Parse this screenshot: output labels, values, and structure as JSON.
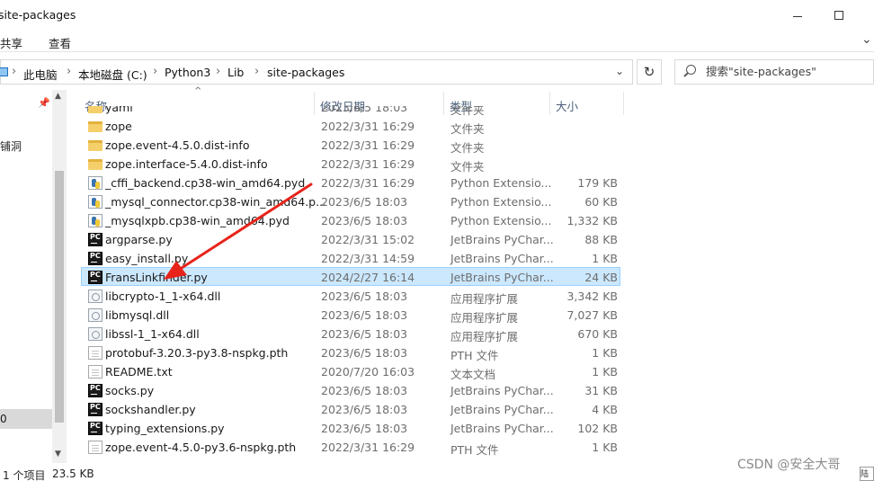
{
  "window": {
    "title": "site-packages"
  },
  "ribbon": {
    "tabs": [
      "共享",
      "查看"
    ]
  },
  "address": {
    "crumbs": [
      "此电脑",
      "本地磁盘 (C:)",
      "Python3",
      "Lib",
      "site-packages"
    ]
  },
  "search": {
    "placeholder": "搜索\"site-packages\""
  },
  "navpane": {
    "item1": "铺洞",
    "selected": "0"
  },
  "columns": {
    "name": "名称",
    "date": "修改日期",
    "type": "类型",
    "size": "大小"
  },
  "files": [
    {
      "name": "yaml",
      "date": "2023/6/5 18:03",
      "type": "文件夹",
      "size": "",
      "icon": "folder-icon"
    },
    {
      "name": "zope",
      "date": "2022/3/31 16:29",
      "type": "文件夹",
      "size": "",
      "icon": "folder-icon"
    },
    {
      "name": "zope.event-4.5.0.dist-info",
      "date": "2022/3/31 16:29",
      "type": "文件夹",
      "size": "",
      "icon": "folder-icon"
    },
    {
      "name": "zope.interface-5.4.0.dist-info",
      "date": "2022/3/31 16:29",
      "type": "文件夹",
      "size": "",
      "icon": "folder-icon"
    },
    {
      "name": "_cffi_backend.cp38-win_amd64.pyd",
      "date": "2022/3/31 16:29",
      "type": "Python Extensio...",
      "size": "179 KB",
      "icon": "python-extension-icon"
    },
    {
      "name": "_mysql_connector.cp38-win_amd64.p...",
      "date": "2023/6/5 18:03",
      "type": "Python Extensio...",
      "size": "60 KB",
      "icon": "python-extension-icon"
    },
    {
      "name": "_mysqlxpb.cp38-win_amd64.pyd",
      "date": "2023/6/5 18:03",
      "type": "Python Extensio...",
      "size": "1,332 KB",
      "icon": "python-extension-icon"
    },
    {
      "name": "argparse.py",
      "date": "2022/3/31 15:02",
      "type": "JetBrains PyChar...",
      "size": "88 KB",
      "icon": "pycharm-file-icon"
    },
    {
      "name": "easy_install.py",
      "date": "2022/3/31 14:59",
      "type": "JetBrains PyChar...",
      "size": "1 KB",
      "icon": "pycharm-file-icon"
    },
    {
      "name": "FransLinkfinder.py",
      "date": "2024/2/27 16:14",
      "type": "JetBrains PyChar...",
      "size": "24 KB",
      "icon": "pycharm-file-icon",
      "selected": true
    },
    {
      "name": "libcrypto-1_1-x64.dll",
      "date": "2023/6/5 18:03",
      "type": "应用程序扩展",
      "size": "3,342 KB",
      "icon": "dll-file-icon"
    },
    {
      "name": "libmysql.dll",
      "date": "2023/6/5 18:03",
      "type": "应用程序扩展",
      "size": "7,027 KB",
      "icon": "dll-file-icon"
    },
    {
      "name": "libssl-1_1-x64.dll",
      "date": "2023/6/5 18:03",
      "type": "应用程序扩展",
      "size": "670 KB",
      "icon": "dll-file-icon"
    },
    {
      "name": "protobuf-3.20.3-py3.8-nspkg.pth",
      "date": "2023/6/5 18:03",
      "type": "PTH 文件",
      "size": "1 KB",
      "icon": "text-file-icon"
    },
    {
      "name": "README.txt",
      "date": "2020/7/20 16:03",
      "type": "文本文档",
      "size": "1 KB",
      "icon": "text-file-icon"
    },
    {
      "name": "socks.py",
      "date": "2023/6/5 18:03",
      "type": "JetBrains PyChar...",
      "size": "31 KB",
      "icon": "pycharm-file-icon"
    },
    {
      "name": "sockshandler.py",
      "date": "2023/6/5 18:03",
      "type": "JetBrains PyChar...",
      "size": "4 KB",
      "icon": "pycharm-file-icon"
    },
    {
      "name": "typing_extensions.py",
      "date": "2023/6/5 18:03",
      "type": "JetBrains PyChar...",
      "size": "102 KB",
      "icon": "pycharm-file-icon"
    },
    {
      "name": "zope.event-4.5.0-py3.6-nspkg.pth",
      "date": "2022/3/31 16:29",
      "type": "PTH 文件",
      "size": "1 KB",
      "icon": "text-file-icon"
    }
  ],
  "status": {
    "count": "1 个项目",
    "size": "23.5 KB"
  },
  "watermark": "CSDN @安全大哥",
  "corner": "陆吕",
  "colors": {
    "selected_row": "#cce8ff",
    "selected_border": "#99d1ff",
    "arrow": "#e8231a"
  }
}
